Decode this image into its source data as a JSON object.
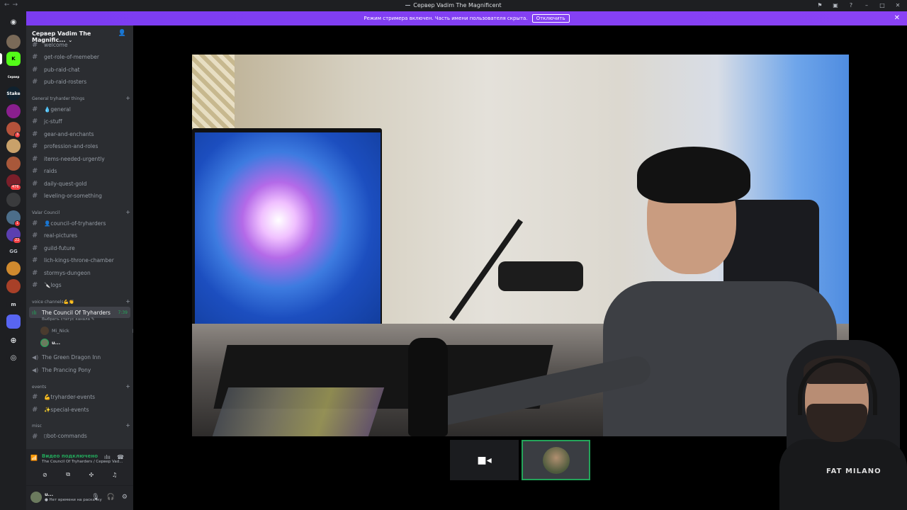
{
  "window": {
    "title": "Сервер Vadim The Magnificent"
  },
  "banner": {
    "text": "Режим стримера включен. Часть имени пользователя скрыта.",
    "button": "Отключить"
  },
  "rail": {
    "servers": [
      {
        "name": "Сервер",
        "label": "Сервер"
      },
      {
        "badge": "3"
      },
      {
        "badge": "476"
      },
      {
        "badge": "1"
      },
      {
        "badge": "22"
      }
    ],
    "labels": [
      "GG",
      "m"
    ]
  },
  "server": {
    "name": "Сервер Vadim The Magnific..."
  },
  "channels": {
    "top": [
      "welcome",
      "get-role-of-memeber",
      "pub-raid-chat",
      "pub-raid-rosters"
    ],
    "categories": [
      {
        "name": "General tryharder things",
        "channels": [
          "💧general",
          "jc-stuff",
          "gear-and-enchants",
          "profession-and-roles",
          "items-needed-urgently",
          "raids",
          "daily-quest-gold",
          "leveling-or-something"
        ]
      },
      {
        "name": "Valar Council",
        "channels": [
          "👤council-of-tryharders",
          "real-pictures",
          "guild-future",
          "lich-kings-throne-chamber",
          "stormys-dungeon",
          "🔪logs"
        ]
      },
      {
        "name": "voice channels💪👏",
        "voice": [
          {
            "name": "The Council Of Tryharders",
            "time": "7:39",
            "status_prompt": "Выбрать статус канала",
            "members": [
              "Mi_Nick",
              "u..."
            ]
          },
          {
            "name": "The Green Dragon Inn"
          },
          {
            "name": "The Prancing Pony"
          }
        ]
      },
      {
        "name": "events",
        "channels": [
          "💪tryharder-events",
          "✨special-events"
        ]
      },
      {
        "name": "misc",
        "channels": [
          "⌷bot-commands"
        ]
      }
    ]
  },
  "voice_panel": {
    "status": "Видео подключено",
    "location": "The Council Of Tryharders / Сервер Vad..."
  },
  "user": {
    "name": "u...",
    "status": "● Нет времени на раскачку"
  },
  "webcam_overlay": {
    "shirt_text": "FAT MILANO"
  },
  "colors": {
    "banner": "#7b3cf1",
    "online_green": "#23a55a",
    "sidebar_bg": "#2b2d31",
    "rail_bg": "#1e1f22"
  }
}
